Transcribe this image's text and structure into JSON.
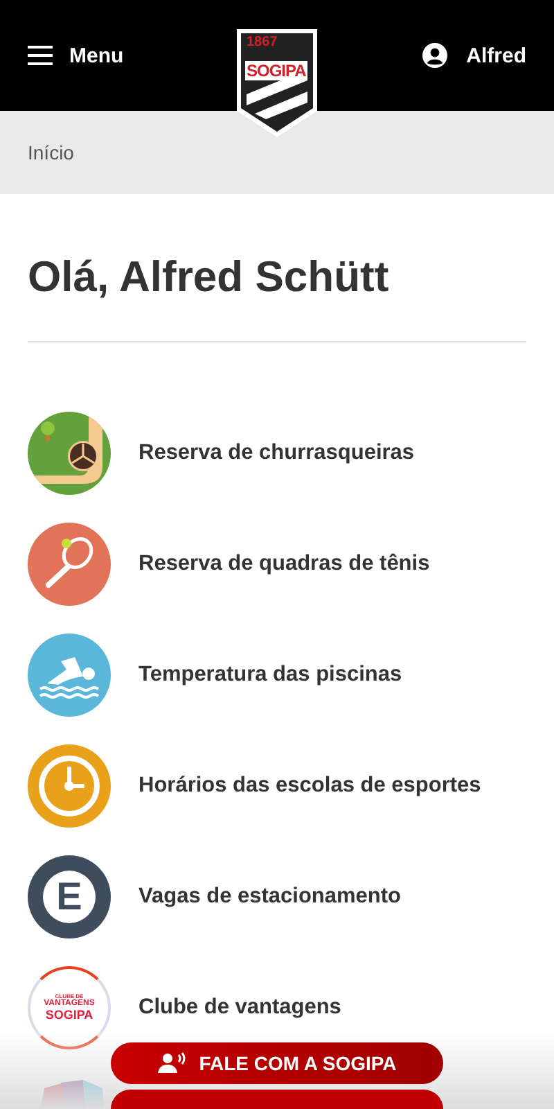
{
  "header": {
    "menu_label": "Menu",
    "logo": {
      "year": "1867",
      "name": "SOGIPA"
    },
    "user_name": "Alfred"
  },
  "breadcrumb": "Início",
  "greeting": "Olá, Alfred Schütt",
  "items": [
    {
      "kind": "barbecue",
      "label": "Reserva de churrasqueiras"
    },
    {
      "kind": "tennis",
      "label": "Reserva de quadras de tênis"
    },
    {
      "kind": "pool",
      "label": "Temperatura das piscinas"
    },
    {
      "kind": "clock",
      "label": "Horários das escolas de esportes"
    },
    {
      "kind": "parking",
      "label": "Vagas de estacionamento",
      "badge": "E"
    },
    {
      "kind": "club",
      "label": "Clube de vantagens",
      "badge_lines": [
        "CLUBE DE",
        "VANTAGENS",
        "SOGIPA"
      ]
    },
    {
      "kind": "project"
    }
  ],
  "contact_button": "FALE COM A SOGIPA"
}
